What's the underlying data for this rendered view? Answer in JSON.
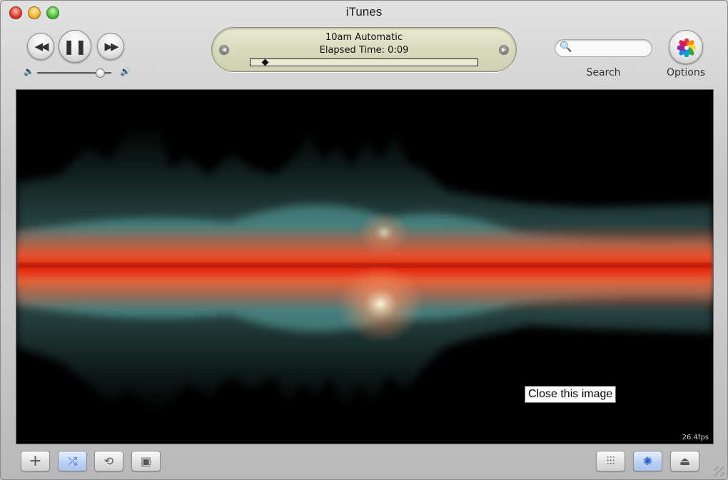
{
  "window": {
    "title": "iTunes"
  },
  "controls": {
    "rewind_icon": "rewind-icon",
    "pause_icon": "pause-icon",
    "fastforward_icon": "fast-forward-icon",
    "volume_level": 0.85
  },
  "display": {
    "track": "10am Automatic",
    "elapsed": "Elapsed Time: 0:09",
    "progress": 0.05
  },
  "search": {
    "label": "Search",
    "placeholder": "",
    "icon": "search-icon"
  },
  "options": {
    "label": "Options",
    "icon": "flower-icon"
  },
  "visualizer": {
    "fps": "26.4fps",
    "overlay_text": "Close this image"
  },
  "bottom_bar": {
    "add_icon": "plus-icon",
    "shuffle_icon": "shuffle-icon",
    "repeat_icon": "repeat-icon",
    "artwork_icon": "artwork-icon",
    "eq_icon": "equalizer-icon",
    "visualizer_icon": "visualizer-icon",
    "eject_icon": "eject-icon"
  },
  "colors": {
    "lcd": "#d9d9bd",
    "accent": "#2a63cf"
  }
}
